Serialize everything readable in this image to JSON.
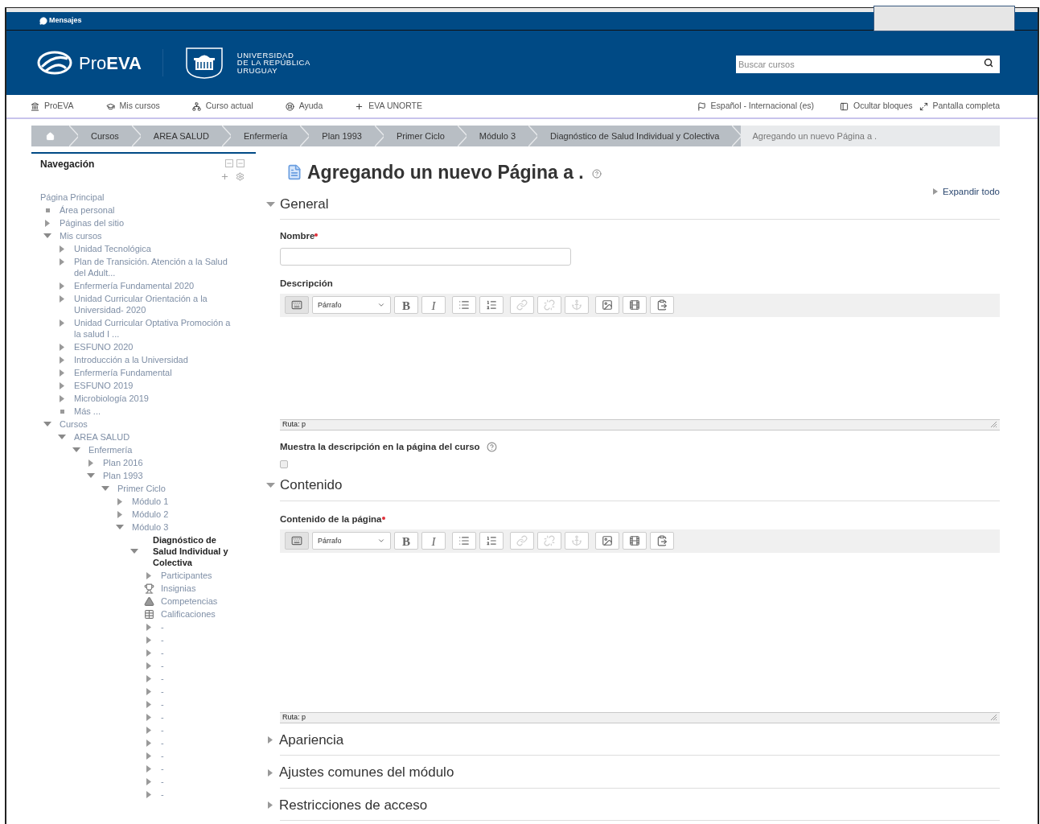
{
  "top_bar": {
    "messages": "Mensajes"
  },
  "header": {
    "brand": "Pro**EVA**",
    "university": [
      "UNIVERSIDAD",
      "DE LA REPÚBLICA",
      "URUGUAY"
    ],
    "search": {
      "placeholder": "Buscar cursos"
    }
  },
  "nav_left": [
    {
      "label": "ProEVA",
      "kind": "home"
    },
    {
      "label": "Mis cursos",
      "kind": "courses"
    },
    {
      "label": "Curso actual",
      "kind": "sitemap"
    },
    {
      "label": "Ayuda",
      "kind": "help"
    },
    {
      "label": "EVA UNORTE",
      "kind": "plus"
    }
  ],
  "nav_right": [
    {
      "label": "Español - Internacional (es)",
      "kind": "flag"
    },
    {
      "label": "Ocultar bloques",
      "kind": "blocks"
    },
    {
      "label": "Pantalla completa",
      "kind": "expand"
    }
  ],
  "breadcrumb": [
    {
      "kind": "home"
    },
    {
      "label": "Cursos",
      "kind": "link"
    },
    {
      "label": "AREA SALUD",
      "kind": "link"
    },
    {
      "label": "Enfermería",
      "kind": "link"
    },
    {
      "label": "Plan 1993",
      "kind": "link"
    },
    {
      "label": "Primer Ciclo",
      "kind": "link"
    },
    {
      "label": "Módulo 3",
      "kind": "link"
    },
    {
      "label": "Diagnóstico de Salud Individual y Colectiva",
      "kind": "link"
    },
    {
      "label": "Agregando un nuevo Página a .",
      "kind": "current"
    }
  ],
  "navigation": {
    "title": "Navegación",
    "tree": [
      {
        "label": "Página Principal",
        "kind": "root",
        "children": [
          {
            "label": "Área personal",
            "kind": "leaf"
          },
          {
            "label": "Páginas del sitio",
            "kind": "branch",
            "expanded": false
          },
          {
            "label": "Mis cursos",
            "kind": "branch",
            "expanded": true,
            "children": [
              {
                "label": "Unidad Tecnológica",
                "kind": "branch",
                "expanded": false
              },
              {
                "label": "Plan de Transición. Atención a la Salud del Adult...",
                "kind": "branch",
                "expanded": false
              },
              {
                "label": "Enfermería Fundamental 2020",
                "kind": "branch",
                "expanded": false
              },
              {
                "label": "Unidad Curricular Orientación a la Universidad- 2020",
                "kind": "branch",
                "expanded": false
              },
              {
                "label": "Unidad Curricular Optativa Promoción a la salud I ...",
                "kind": "branch",
                "expanded": false
              },
              {
                "label": "ESFUNO 2020",
                "kind": "branch",
                "expanded": false
              },
              {
                "label": "Introducción a la Universidad",
                "kind": "branch",
                "expanded": false
              },
              {
                "label": "Enfermería Fundamental",
                "kind": "branch",
                "expanded": false
              },
              {
                "label": "ESFUNO 2019",
                "kind": "branch",
                "expanded": false
              },
              {
                "label": "Microbiología 2019",
                "kind": "branch",
                "expanded": false
              },
              {
                "label": "Más ...",
                "kind": "leaf"
              }
            ]
          },
          {
            "label": "Cursos",
            "kind": "branch",
            "expanded": true,
            "children": [
              {
                "label": "AREA SALUD",
                "kind": "branch",
                "expanded": true,
                "children": [
                  {
                    "label": "Enfermería",
                    "kind": "branch",
                    "expanded": true,
                    "children": [
                      {
                        "label": "Plan 2016",
                        "kind": "branch",
                        "expanded": false
                      },
                      {
                        "label": "Plan 1993",
                        "kind": "branch",
                        "expanded": true,
                        "children": [
                          {
                            "label": "Primer Ciclo",
                            "kind": "branch",
                            "expanded": true,
                            "children": [
                              {
                                "label": "Módulo 1",
                                "kind": "branch",
                                "expanded": false
                              },
                              {
                                "label": "Módulo 2",
                                "kind": "branch",
                                "expanded": false
                              },
                              {
                                "label": "Módulo 3",
                                "kind": "branch",
                                "expanded": true,
                                "children": [
                                  {
                                    "label": "Diagnóstico de Salud Individual y Colectiva",
                                    "kind": "branch",
                                    "expanded": true,
                                    "current": true,
                                    "children": [
                                      {
                                        "label": "Participantes",
                                        "kind": "branch",
                                        "expanded": false
                                      },
                                      {
                                        "label": "Insignias",
                                        "kind": "trophy"
                                      },
                                      {
                                        "label": "Competencias",
                                        "kind": "competency"
                                      },
                                      {
                                        "label": "Calificaciones",
                                        "kind": "grades"
                                      },
                                      {
                                        "label": "-",
                                        "kind": "branch",
                                        "expanded": false
                                      },
                                      {
                                        "label": "-",
                                        "kind": "branch",
                                        "expanded": false
                                      },
                                      {
                                        "label": "-",
                                        "kind": "branch",
                                        "expanded": false
                                      },
                                      {
                                        "label": "-",
                                        "kind": "branch",
                                        "expanded": false
                                      },
                                      {
                                        "label": "-",
                                        "kind": "branch",
                                        "expanded": false
                                      },
                                      {
                                        "label": "-",
                                        "kind": "branch",
                                        "expanded": false
                                      },
                                      {
                                        "label": "-",
                                        "kind": "branch",
                                        "expanded": false
                                      },
                                      {
                                        "label": "-",
                                        "kind": "branch",
                                        "expanded": false
                                      },
                                      {
                                        "label": "-",
                                        "kind": "branch",
                                        "expanded": false
                                      },
                                      {
                                        "label": "-",
                                        "kind": "branch",
                                        "expanded": false
                                      },
                                      {
                                        "label": "-",
                                        "kind": "branch",
                                        "expanded": false
                                      },
                                      {
                                        "label": "-",
                                        "kind": "branch",
                                        "expanded": false
                                      },
                                      {
                                        "label": "-",
                                        "kind": "branch",
                                        "expanded": false
                                      },
                                      {
                                        "label": "-",
                                        "kind": "branch",
                                        "expanded": false
                                      }
                                    ]
                                  }
                                ]
                              }
                            ]
                          }
                        ]
                      }
                    ]
                  }
                ]
              }
            ]
          }
        ]
      }
    ]
  },
  "page": {
    "title": "Agregando un nuevo Página a .",
    "expand_all": "Expandir todo",
    "sections": [
      {
        "title": "General",
        "expanded": true,
        "fields": [
          {
            "kind": "text",
            "label": "Nombre",
            "required": true
          },
          {
            "kind": "editor",
            "label": "Descripción",
            "format": "Párrafo",
            "path": "Ruta: p",
            "toolbar": [
              {
                "kind": "toggle",
                "disabled": false
              },
              {
                "kind": "format"
              },
              {
                "kind": "bold",
                "label": "B",
                "disabled": false
              },
              {
                "kind": "italic",
                "label": "I",
                "disabled": false
              },
              {
                "kind": "ul",
                "disabled": false
              },
              {
                "kind": "ol",
                "disabled": false
              },
              {
                "kind": "link",
                "disabled": true
              },
              {
                "kind": "unlink",
                "disabled": true
              },
              {
                "kind": "anchor",
                "disabled": true
              },
              {
                "kind": "image",
                "disabled": false
              },
              {
                "kind": "media",
                "disabled": false
              },
              {
                "kind": "paste",
                "disabled": false
              }
            ]
          },
          {
            "kind": "checkbox",
            "label": "Muestra la descripción en la página del curso",
            "checked": false
          }
        ]
      },
      {
        "title": "Contenido",
        "expanded": true,
        "fields": [
          {
            "kind": "editor",
            "label": "Contenido de la página",
            "required": true,
            "format": "Párrafo",
            "path": "Ruta: p",
            "toolbar": [
              {
                "kind": "toggle",
                "disabled": false
              },
              {
                "kind": "format"
              },
              {
                "kind": "bold",
                "label": "B",
                "disabled": false
              },
              {
                "kind": "italic",
                "label": "I",
                "disabled": false
              },
              {
                "kind": "ul",
                "disabled": false
              },
              {
                "kind": "ol",
                "disabled": false
              },
              {
                "kind": "link",
                "disabled": true
              },
              {
                "kind": "unlink",
                "disabled": true
              },
              {
                "kind": "anchor",
                "disabled": true
              },
              {
                "kind": "image",
                "disabled": false
              },
              {
                "kind": "media",
                "disabled": false
              },
              {
                "kind": "paste",
                "disabled": false
              }
            ]
          }
        ]
      },
      {
        "title": "Apariencia",
        "expanded": false
      },
      {
        "title": "Ajustes comunes del módulo",
        "expanded": false
      },
      {
        "title": "Restricciones de acceso",
        "expanded": false
      }
    ]
  }
}
